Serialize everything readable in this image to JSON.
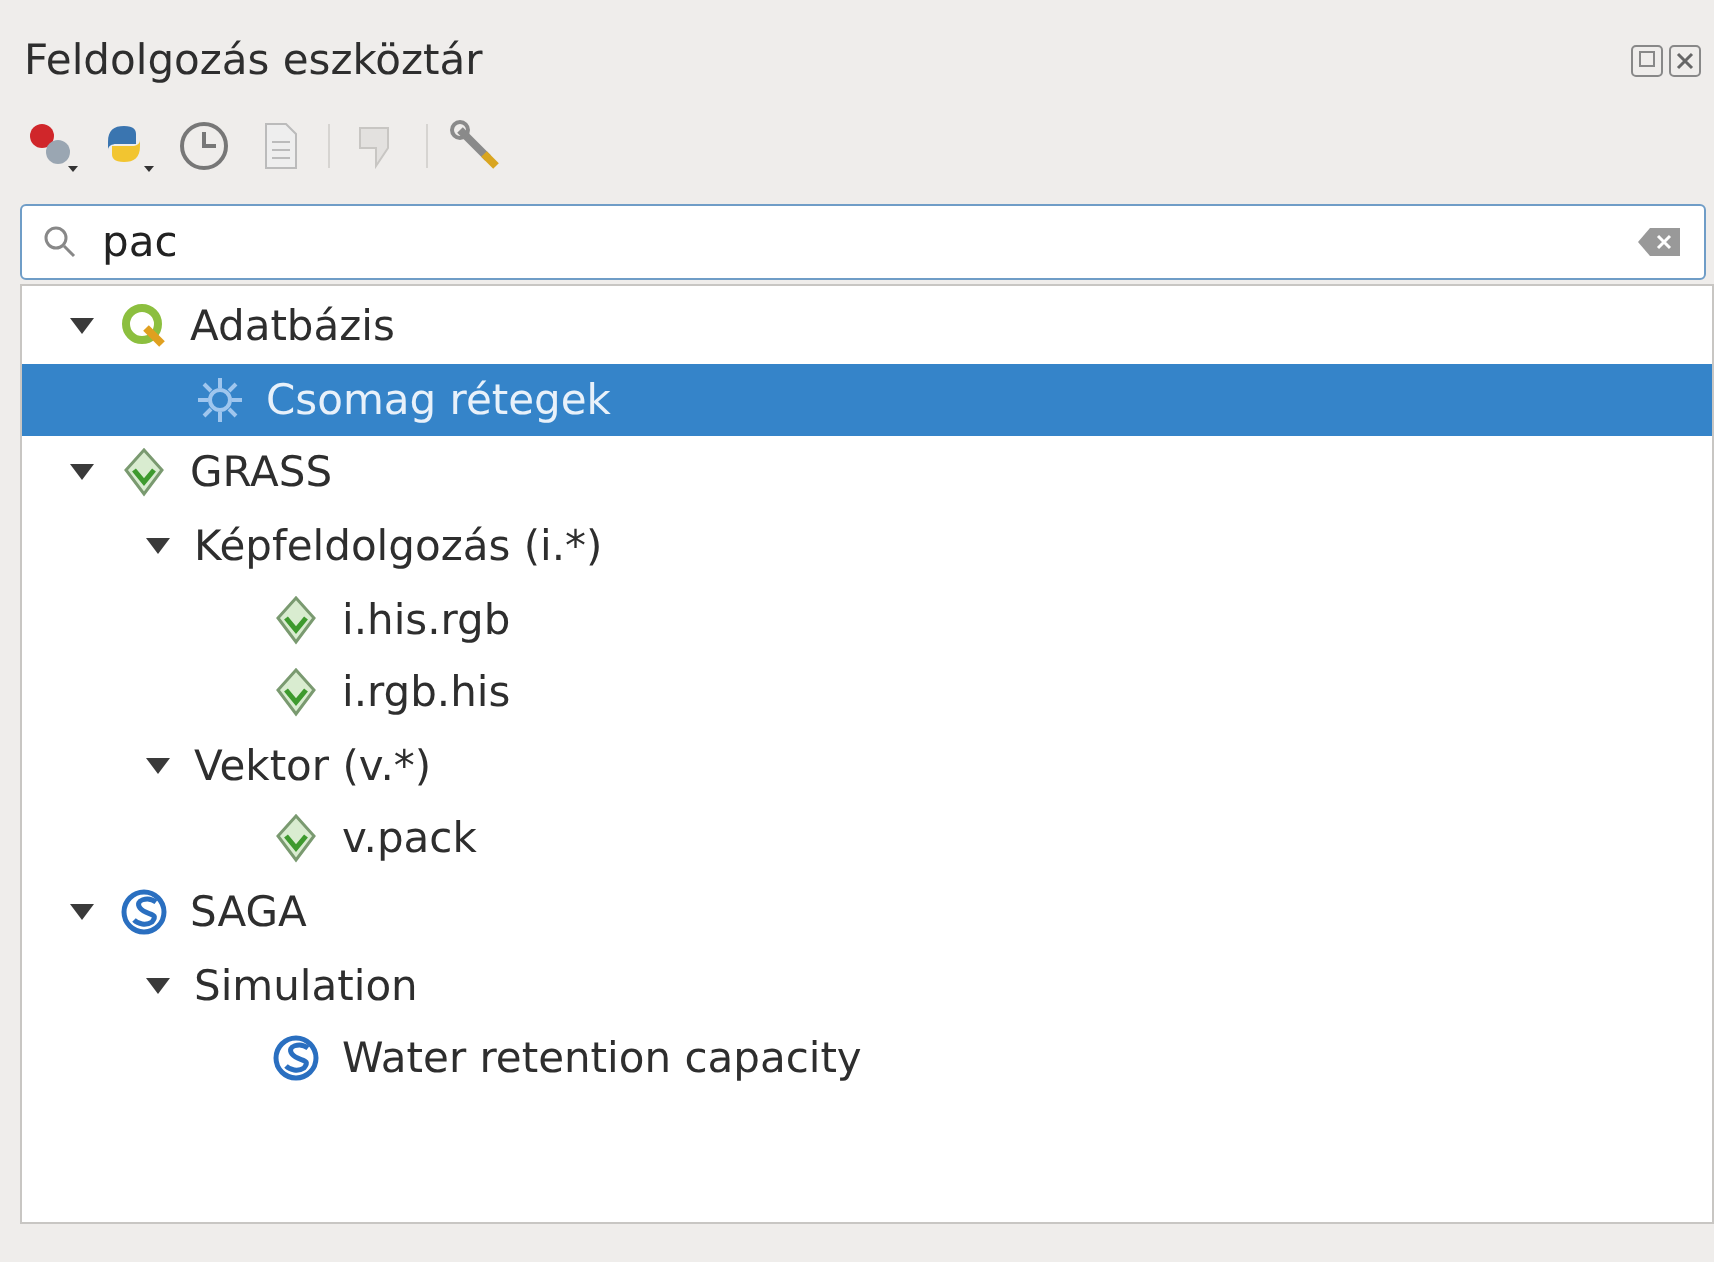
{
  "panel": {
    "title": "Feldolgozás eszköztár"
  },
  "search": {
    "value": "pac"
  },
  "tree": [
    {
      "label": "Adatbázis",
      "kind": "qgis",
      "expanded": true,
      "selected": false,
      "children": [
        {
          "label": "Csomag rétegek",
          "kind": "gear",
          "selected": true
        }
      ]
    },
    {
      "label": "GRASS",
      "kind": "grass",
      "expanded": true,
      "selected": false,
      "children": [
        {
          "label": "Képfeldolgozás (i.*)",
          "kind": "none",
          "expanded": true,
          "selected": false,
          "children": [
            {
              "label": "i.his.rgb",
              "kind": "grass",
              "selected": false
            },
            {
              "label": "i.rgb.his",
              "kind": "grass",
              "selected": false
            }
          ]
        },
        {
          "label": "Vektor (v.*)",
          "kind": "none",
          "expanded": true,
          "selected": false,
          "children": [
            {
              "label": "v.pack",
              "kind": "grass",
              "selected": false
            }
          ]
        }
      ]
    },
    {
      "label": "SAGA",
      "kind": "saga",
      "expanded": true,
      "selected": false,
      "children": [
        {
          "label": "Simulation",
          "kind": "none",
          "expanded": true,
          "selected": false,
          "children": [
            {
              "label": "Water retention capacity",
              "kind": "saga",
              "selected": false
            }
          ]
        }
      ]
    }
  ]
}
